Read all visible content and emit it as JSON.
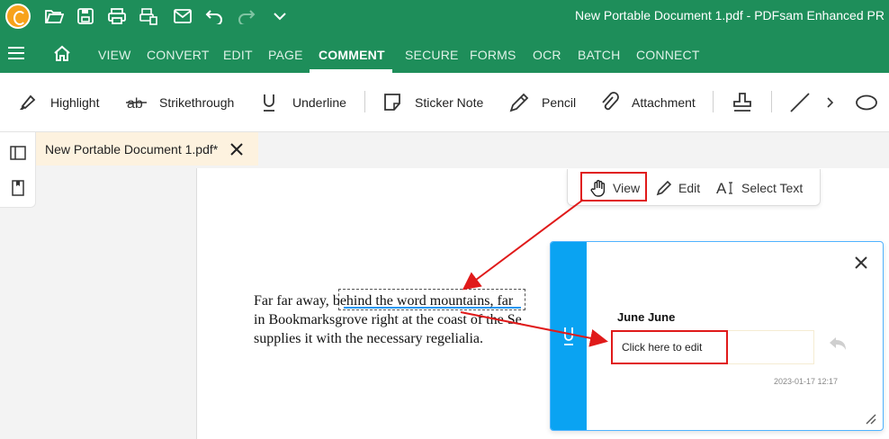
{
  "window": {
    "title": "New Portable Document 1.pdf   -   PDFsam Enhanced PR",
    "accent": "#1e8e5a"
  },
  "quick_access": [
    "app-logo-icon",
    "open-folder-icon",
    "save-icon",
    "print-icon",
    "scan-icon",
    "mail-icon",
    "undo-icon",
    "redo-icon",
    "chevron-down-icon"
  ],
  "menu": {
    "items": [
      "VIEW",
      "CONVERT",
      "EDIT",
      "PAGE",
      "COMMENT",
      "SECURE",
      "FORMS",
      "OCR",
      "BATCH",
      "CONNECT"
    ],
    "active": "COMMENT"
  },
  "toolbar": {
    "highlight": "Highlight",
    "strikethrough": "Strikethrough",
    "underline": "Underline",
    "sticker_note": "Sticker Note",
    "pencil": "Pencil",
    "attachment": "Attachment"
  },
  "tab": {
    "label": "New Portable Document 1.pdf*"
  },
  "mode_bar": {
    "view": "View",
    "edit": "Edit",
    "select_text": "Select Text"
  },
  "document": {
    "line1_before": "Far far away, ",
    "line1_anno": "behind the word mountains,",
    "line1_after": " far",
    "line2": "in Bookmarksgrove right at the coast of the Se",
    "line3": "supplies it with the necessary regelialia."
  },
  "popup": {
    "author": "June June",
    "placeholder": "Click here to edit",
    "timestamp": "2023-01-17 12:17",
    "strip_color": "#0aa3f2"
  },
  "highlight_color": "#e01a1a"
}
